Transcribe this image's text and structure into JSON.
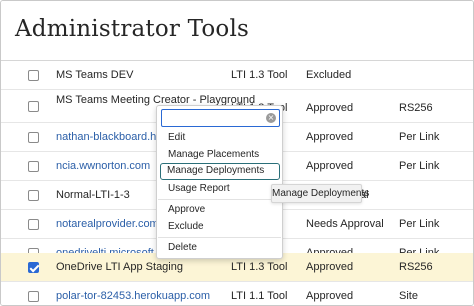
{
  "page": {
    "title": "Administrator Tools"
  },
  "rows": [
    {
      "name": "MS Teams DEV",
      "link": false,
      "type": "LTI 1.3 Tool",
      "status": "Excluded",
      "extra": "",
      "checked": false
    },
    {
      "name": "MS Teams Meeting Creator - Playground",
      "link": false,
      "type": "LTI 1.3 Tool",
      "status": "Approved",
      "extra": "RS256",
      "checked": false
    },
    {
      "name": "nathan-blackboard.h5p.com",
      "link": true,
      "type": "",
      "status": "Approved",
      "extra": "Per Link",
      "checked": false
    },
    {
      "name": "ncia.wwnorton.com",
      "link": true,
      "type": "",
      "status": "Approved",
      "extra": "Per Link",
      "checked": false
    },
    {
      "name": "Normal-LTI-1-3",
      "link": false,
      "type": "",
      "status": "",
      "extra": "",
      "checked": false
    },
    {
      "name": "notarealprovider.com",
      "link": true,
      "type": "",
      "status": "Needs Approval",
      "extra": "Per Link",
      "checked": false
    },
    {
      "name": "onedrivelti.microsoft.com",
      "link": true,
      "type": "",
      "status": "Approved",
      "extra": "Per Link",
      "checked": false
    },
    {
      "name": "OneDrive LTI App Staging",
      "link": false,
      "type": "LTI 1.3 Tool",
      "status": "Approved",
      "extra": "RS256",
      "checked": true
    },
    {
      "name": "polar-tor-82453.herokuapp.com",
      "link": true,
      "type": "LTI 1.1 Tool",
      "status": "Approved",
      "extra": "Site",
      "checked": false
    }
  ],
  "menu": {
    "search_value": "",
    "clear_icon": "×",
    "items": {
      "edit": "Edit",
      "manage_placements": "Manage Placements",
      "manage_deployments": "Manage Deployments",
      "usage_report": "Usage Report",
      "approve": "Approve",
      "exclude": "Exclude",
      "delete": "Delete"
    }
  },
  "tooltip": {
    "text": "Manage Deployments"
  },
  "partial_text": {
    "normal_lti_status_tail": "al"
  },
  "colors": {
    "accent": "#2a69d4",
    "link": "#2b5fa8",
    "focus_ring": "#2a6f79",
    "selected_row": "#fcf5d6"
  }
}
